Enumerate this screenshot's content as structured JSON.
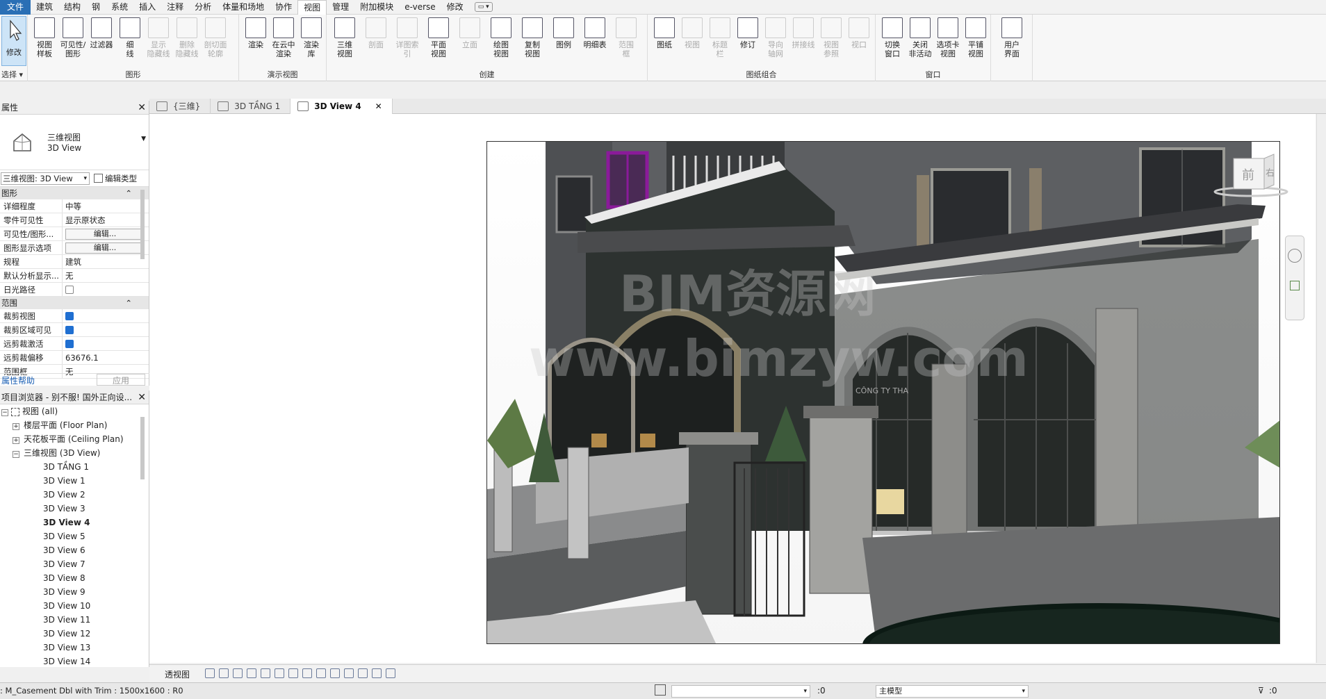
{
  "menu": [
    "文件",
    "建筑",
    "结构",
    "钢",
    "系统",
    "插入",
    "注释",
    "分析",
    "体量和场地",
    "协作",
    "视图",
    "管理",
    "附加模块",
    "e-verse",
    "修改"
  ],
  "menu_active": "视图",
  "ribbon": {
    "select": {
      "label": "修改",
      "group": "选择"
    },
    "graphics": {
      "group": "图形",
      "buttons": [
        "视图\n样板",
        "可见性/\n图形",
        "过滤器",
        "细\n线",
        "显示\n隐藏线",
        "删除\n隐藏线",
        "剖切面\n轮廓"
      ]
    },
    "presentation": {
      "group": "演示视图",
      "buttons": [
        "渲染",
        "在云中\n渲染",
        "渲染\n库"
      ]
    },
    "create": {
      "group": "创建",
      "buttons": [
        "三维\n视图",
        "剖面",
        "详图索引",
        "平面\n视图",
        "立面",
        "绘图\n视图",
        "复制\n视图",
        "图例",
        "明细表",
        "范围\n框"
      ]
    },
    "sheet": {
      "group": "图纸组合",
      "buttons": [
        "图纸",
        "视图",
        "标题\n栏",
        "修订",
        "导向\n轴网",
        "拼接线",
        "视图\n参照",
        "视口"
      ]
    },
    "window": {
      "group": "窗口",
      "buttons": [
        "切换\n窗口",
        "关闭\n非活动",
        "选项卡\n视图",
        "平铺\n视图"
      ]
    },
    "ui": {
      "buttons": [
        "用户\n界面"
      ]
    }
  },
  "properties": {
    "title": "属性",
    "type_name": "三维视图",
    "type_sub": "3D View",
    "instance_selector": "三维视图: 3D View",
    "edit_type": "编辑类型",
    "section_graphics": "图形",
    "rows_graphics": [
      {
        "k": "详细程度",
        "v": "中等"
      },
      {
        "k": "零件可见性",
        "v": "显示原状态"
      },
      {
        "k": "可见性/图形...",
        "v": "编辑...",
        "btn": true
      },
      {
        "k": "图形显示选项",
        "v": "编辑...",
        "btn": true
      },
      {
        "k": "规程",
        "v": "建筑"
      },
      {
        "k": "默认分析显示...",
        "v": "无"
      },
      {
        "k": "日光路径",
        "v": "",
        "chk": false
      }
    ],
    "section_extent": "范围",
    "rows_extent": [
      {
        "k": "裁剪视图",
        "v": "",
        "chk": true
      },
      {
        "k": "裁剪区域可见",
        "v": "",
        "chk": true
      },
      {
        "k": "远剪裁激活",
        "v": "",
        "chk": true
      },
      {
        "k": "远剪裁偏移",
        "v": "63676.1"
      },
      {
        "k": "范围框",
        "v": "无"
      }
    ],
    "help": "属性帮助",
    "apply": "应用"
  },
  "browser": {
    "title": "项目浏览器 - 别不服! 国外正向设...",
    "root": "视图 (all)",
    "groups": [
      "楼层平面 (Floor Plan)",
      "天花板平面 (Ceiling Plan)",
      "三维视图 (3D View)"
    ],
    "items": [
      "3D TẦNG 1",
      "3D View 1",
      "3D View 2",
      "3D View 3",
      "3D View 4",
      "3D View 5",
      "3D View 6",
      "3D View 7",
      "3D View 8",
      "3D View 9",
      "3D View 10",
      "3D View 11",
      "3D View 12",
      "3D View 13",
      "3D View 14"
    ],
    "active": "3D View 4"
  },
  "tabs": [
    {
      "label": "{三维}",
      "active": false
    },
    {
      "label": "3D TẦNG 1",
      "active": false
    },
    {
      "label": "3D View 4",
      "active": true
    }
  ],
  "viewcube": {
    "front": "前",
    "right": "右"
  },
  "watermark": {
    "line1": "BIM资源网",
    "line2": "www.bimzyw.com"
  },
  "sign_text": "CÔNG TY THA",
  "viewbar": {
    "mode": "透视图"
  },
  "status": {
    "selection": ": M_Casement Dbl with Trim : 1500x1600 : R0",
    "count1": ":0",
    "model": "主模型",
    "filter": ":0"
  },
  "colors": {
    "accent": "#2a6fb5",
    "highlight": "#8b1a9a"
  }
}
